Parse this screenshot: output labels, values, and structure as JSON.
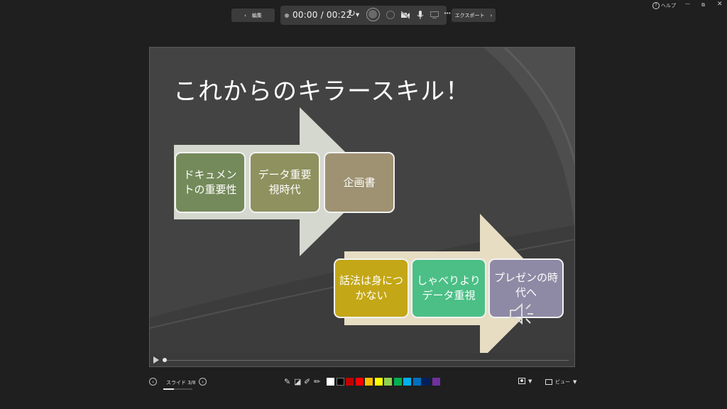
{
  "toolbar": {
    "edit_label": "編集",
    "time_current": "00:00",
    "time_separator": "/",
    "time_total": "00:22",
    "more_label": "•••",
    "export_label": "エクスポート",
    "help_label": "ヘルプ"
  },
  "slide": {
    "title": "これからのキラースキル！",
    "row1": [
      {
        "text": "ドキュメントの重要性",
        "color": "#748a5a"
      },
      {
        "text": "データ重要視時代",
        "color": "#8f915f"
      },
      {
        "text": "企画書",
        "color": "#9e9272"
      }
    ],
    "row2": [
      {
        "text": "話法は身につかない",
        "color": "#c3a716"
      },
      {
        "text": "しゃべりよりデータ重視",
        "color": "#4bbf86"
      },
      {
        "text": "プレゼンの時代へ",
        "color": "#8e8aa5"
      }
    ],
    "arrow1_color": "#d5d8cf",
    "arrow2_color": "#e6ddc3"
  },
  "footer": {
    "slide_counter": "スライド 3/8",
    "view_label": "ビュー",
    "palette": [
      "#ffffff",
      "#000000",
      "#c00000",
      "#ff0000",
      "#ffc000",
      "#ffff00",
      "#92d050",
      "#00b050",
      "#00b0f0",
      "#0070c0",
      "#002060",
      "#7030a0"
    ]
  }
}
